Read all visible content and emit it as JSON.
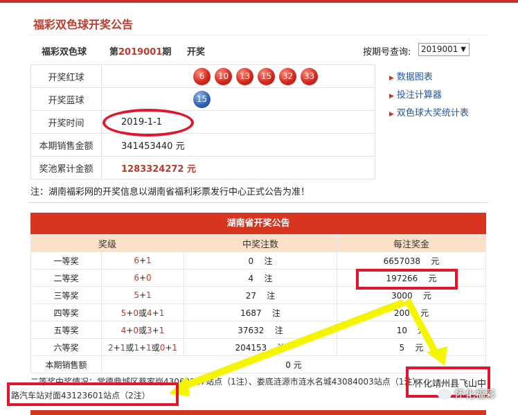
{
  "header": {
    "title": "福彩双色球开奖公告"
  },
  "subheader": {
    "lottery": "福彩双色球",
    "issue_prefix": "第",
    "issue_no": "2019001",
    "issue_suffix": "期",
    "draw": "开奖",
    "query_label": "按期号查询:",
    "query_value": "2019001"
  },
  "info": {
    "red_label": "开奖红球",
    "reds": [
      "6",
      "10",
      "13",
      "15",
      "32",
      "33"
    ],
    "blue_label": "开奖蓝球",
    "blue": "15",
    "time_label": "开奖时间",
    "time_value": "2019-1-1",
    "sales_label": "本期销售金额",
    "sales_value": "341453440 元",
    "pool_label": "奖池累计金额",
    "pool_value": "1283324272 元"
  },
  "sidebar": {
    "links": [
      "数据图表",
      "投注计算器",
      "双色球大奖统计表"
    ]
  },
  "note": "注：湖南福彩网的开奖信息以湖南省福利彩票发行中心正式公告为准！",
  "prize_table": {
    "title": "湖南省开奖公告",
    "headers": [
      "奖级",
      "中奖注数",
      "每注奖金"
    ],
    "rows": [
      {
        "level": "一等奖",
        "cond": "6+1",
        "count": "0",
        "count_unit": "注",
        "prize": "6657038",
        "prize_unit": "元"
      },
      {
        "level": "二等奖",
        "cond": "6+0",
        "count": "4",
        "count_unit": "注",
        "prize": "197266",
        "prize_unit": "元"
      },
      {
        "level": "三等奖",
        "cond": "5+1",
        "count": "27",
        "count_unit": "注",
        "prize": "3000",
        "prize_unit": "元"
      },
      {
        "level": "四等奖",
        "cond": "5+0或4+1",
        "count": "1687",
        "count_unit": "注",
        "prize": "200",
        "prize_unit": "元"
      },
      {
        "level": "五等奖",
        "cond": "4+0或3+1",
        "count": "37632",
        "count_unit": "注",
        "prize": "10",
        "prize_unit": "元"
      },
      {
        "level": "六等奖",
        "cond": "2+1或1+1或0+1",
        "count": "204153",
        "count_unit": "注",
        "prize": "5",
        "prize_unit": "元"
      }
    ],
    "sales_label": "本期销售额",
    "sales_value": "0 元"
  },
  "footer": {
    "line1": "二等奖中奖情况：常德鼎城区蔡家岗43069127站点（1注）、娄底涟源市涟水名城43084003站点（1注）",
    "highlight": "怀化靖州县飞山中",
    "line2": "路汽车站对面43123601站点（2注）"
  },
  "watermark": "怀化福彩",
  "colors": {
    "accent": "#d8341e",
    "annotation": "#e3152b",
    "arrow": "#f5f500"
  }
}
